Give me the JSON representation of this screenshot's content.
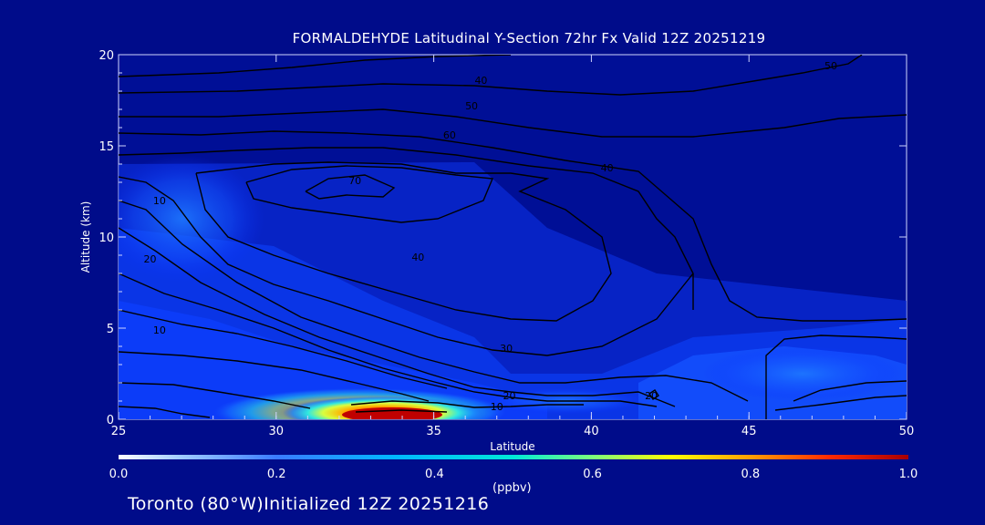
{
  "chart_data": {
    "type": "heatmap",
    "title": "FORMALDEHYDE Latitudinal Y-Section 72hr  Fx Valid 12Z 20251219",
    "xlabel": "Latitude",
    "ylabel": "Altitude (km)",
    "xlim": [
      25,
      50
    ],
    "ylim": [
      0,
      20
    ],
    "x_ticks": [
      "25",
      "30",
      "35",
      "40",
      "45",
      "50"
    ],
    "y_ticks": [
      "0",
      "5",
      "10",
      "15",
      "20"
    ],
    "colorbar": {
      "min": 0.0,
      "max": 1.0,
      "ticks": [
        "0.0",
        "0.2",
        "0.4",
        "0.6",
        "0.8",
        "1.0"
      ],
      "units": "(ppbv)"
    },
    "hotspots": [
      {
        "lat": 34.0,
        "alt": 0.3,
        "value": 1.0
      },
      {
        "lat": 33.5,
        "alt": 0.6,
        "value": 0.75
      },
      {
        "lat": 32.5,
        "alt": 0.5,
        "value": 0.5
      },
      {
        "lat": 30.5,
        "alt": 0.4,
        "value": 0.3
      },
      {
        "lat": 38.5,
        "alt": 0.9,
        "value": 0.2
      },
      {
        "lat": 46.0,
        "alt": 2.5,
        "value": 0.15
      },
      {
        "lat": 28.0,
        "alt": 11.0,
        "value": 0.12
      }
    ],
    "contour_labels": [
      {
        "text": "10",
        "lat": 26.3,
        "alt": 11.8
      },
      {
        "text": "20",
        "lat": 26.0,
        "alt": 8.6
      },
      {
        "text": "10",
        "lat": 26.3,
        "alt": 4.7
      },
      {
        "text": "70",
        "lat": 32.5,
        "alt": 12.9
      },
      {
        "text": "60",
        "lat": 35.5,
        "alt": 15.4
      },
      {
        "text": "50",
        "lat": 36.2,
        "alt": 17.0
      },
      {
        "text": "40",
        "lat": 36.5,
        "alt": 18.4
      },
      {
        "text": "40",
        "lat": 40.5,
        "alt": 13.6
      },
      {
        "text": "50",
        "lat": 47.6,
        "alt": 19.2
      },
      {
        "text": "40",
        "lat": 34.5,
        "alt": 8.7
      },
      {
        "text": "30",
        "lat": 37.3,
        "alt": 3.7
      },
      {
        "text": "20",
        "lat": 37.4,
        "alt": 1.1
      },
      {
        "text": "10",
        "lat": 37.0,
        "alt": 0.5
      },
      {
        "text": "20",
        "lat": 41.9,
        "alt": 1.1
      }
    ]
  },
  "footer": "Toronto (80°W)Initialized 12Z 20251216"
}
